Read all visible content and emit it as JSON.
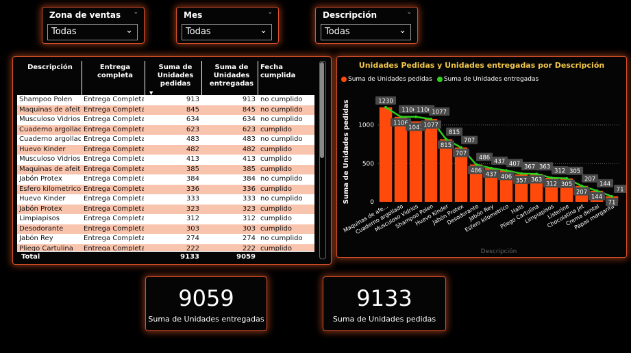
{
  "slicers": [
    {
      "label": "Zona de ventas",
      "value": "Todas"
    },
    {
      "label": "Mes",
      "value": "Todas"
    },
    {
      "label": "Descripción",
      "value": "Todas"
    }
  ],
  "table": {
    "headers": [
      "Descripción",
      "Entrega completa",
      "Suma de Unidades pedidas",
      "Suma de Unidades entregadas",
      "Fecha cumplida"
    ],
    "rows": [
      [
        "Shampoo Polen",
        "Entrega Completa",
        "913",
        "913",
        "no cumplido"
      ],
      [
        "Maquinas de afeitar",
        "Entrega Completa",
        "845",
        "845",
        "no cumplido"
      ],
      [
        "Musculoso Vidrios",
        "Entrega Completa",
        "634",
        "634",
        "no cumplido"
      ],
      [
        "Cuaderno argollado",
        "Entrega Completa",
        "623",
        "623",
        "cumplido"
      ],
      [
        "Cuaderno argollado",
        "Entrega Completa",
        "483",
        "483",
        "no cumplido"
      ],
      [
        "Huevo Kinder",
        "Entrega Completa",
        "482",
        "482",
        "cumplido"
      ],
      [
        "Musculoso Vidrios",
        "Entrega Completa",
        "413",
        "413",
        "cumplido"
      ],
      [
        "Maquinas de afeitar",
        "Entrega Completa",
        "385",
        "385",
        "cumplido"
      ],
      [
        "Jabón Protex",
        "Entrega Completa",
        "384",
        "384",
        "no cumplido"
      ],
      [
        "Esfero kilometrico",
        "Entrega Completa",
        "336",
        "336",
        "cumplido"
      ],
      [
        "Huevo Kinder",
        "Entrega Completa",
        "333",
        "333",
        "no cumplido"
      ],
      [
        "Jabón Protex",
        "Entrega Completa",
        "323",
        "323",
        "cumplido"
      ],
      [
        "Limpiapisos",
        "Entrega Completa",
        "312",
        "312",
        "cumplido"
      ],
      [
        "Desodorante",
        "Entrega Completa",
        "303",
        "303",
        "cumplido"
      ],
      [
        "Jabón Rey",
        "Entrega Completa",
        "274",
        "274",
        "no cumplido"
      ],
      [
        "Pliego Cartulina",
        "Entrega Completa",
        "222",
        "222",
        "cumplido"
      ]
    ],
    "total": {
      "label": "Total",
      "pedidas": "9133",
      "entregadas": "9059"
    }
  },
  "chart_data": {
    "type": "bar",
    "title": "Unidades Pedidas y Unidades entregadas por Descripción",
    "xlabel": "Descripción",
    "ylabel": "Suma de Unidades pedidas",
    "ylim": [
      0,
      1300
    ],
    "yticks": [
      "0",
      "500",
      "1000"
    ],
    "grid": true,
    "legend_position": "top-left",
    "categories": [
      "Maquinas de afe...",
      "Cuaderno argollado",
      "Musculoso Vidrios",
      "Shampoo Polen",
      "Huevo Kinder",
      "Jabón Protex",
      "Desodorante",
      "Jabón Rey",
      "Esfero kilometrico",
      "Halls",
      "Pliego Cartulina",
      "Limpiapisos",
      "Listerine",
      "Chocolatina Jet",
      "Crema dental",
      "Papas margarita"
    ],
    "series": [
      {
        "name": "Suma de Unidades pedidas",
        "kind": "bar",
        "color": "#ff4a0c",
        "values": [
          1230,
          1106,
          1047,
          1077,
          815,
          707,
          486,
          437,
          406,
          357,
          363,
          312,
          305,
          207,
          144,
          71
        ]
      },
      {
        "name": "Suma de Unidades entregadas",
        "kind": "line",
        "color": "#2fd11f",
        "values": [
          1230,
          1106,
          1106,
          1077,
          815,
          707,
          486,
          437,
          407,
          367,
          363,
          312,
          305,
          207,
          144,
          71
        ]
      }
    ]
  },
  "kpis": [
    {
      "value": "9059",
      "label": "Suma de Unidades entregadas"
    },
    {
      "value": "9133",
      "label": "Suma de Unidades pedidas"
    }
  ]
}
